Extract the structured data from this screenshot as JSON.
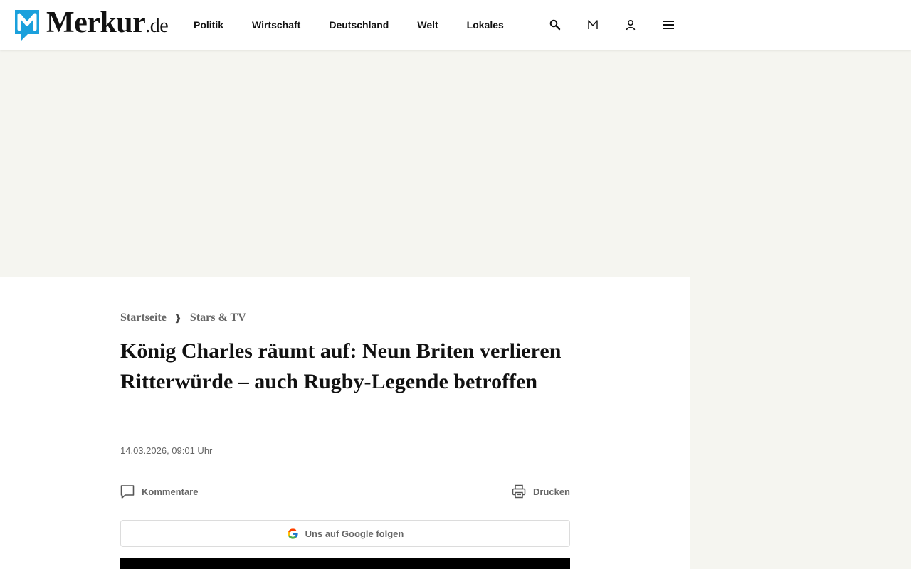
{
  "header": {
    "logo": {
      "name": "Merkur",
      "tld": ".de"
    },
    "nav": [
      "Politik",
      "Wirtschaft",
      "Deutschland",
      "Welt",
      "Lokales"
    ],
    "icons": [
      "search-icon",
      "m-icon",
      "user-icon",
      "menu-icon"
    ]
  },
  "article": {
    "breadcrumb": [
      "Startseite",
      "Stars & TV"
    ],
    "breadcrumb_separator": "❱",
    "title": "König Charles räumt auf: Neun Briten verlieren Ritterwürde – auch Rugby-Legende betroffen",
    "date": "14.03.2026, 09:01 Uhr",
    "actions": {
      "comments": "Kommentare",
      "print": "Drucken"
    },
    "google_follow": "Uns auf Google folgen"
  },
  "colors": {
    "brand_blue": "#1aa0dc",
    "page_background": "#f5f5f0",
    "text_muted": "#666666"
  }
}
